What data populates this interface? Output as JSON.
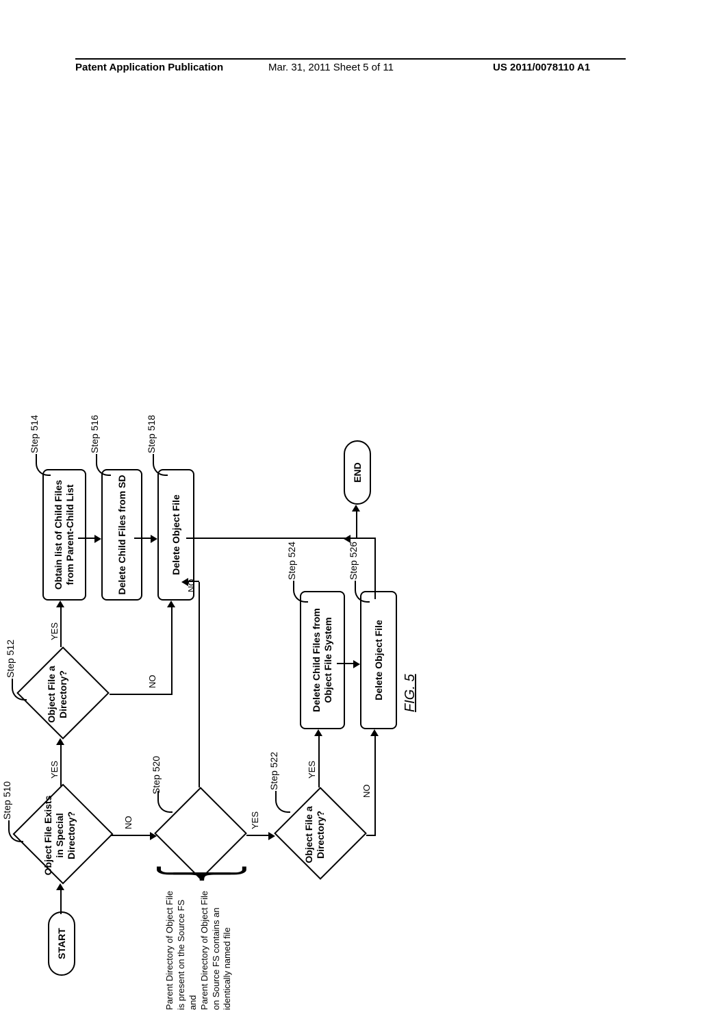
{
  "header": {
    "left": "Patent Application Publication",
    "middle": "Mar. 31, 2011  Sheet 5 of 11",
    "right": "US 2011/0078110 A1"
  },
  "figure": "FIG. 5",
  "labels": {
    "yes": "YES",
    "no": "NO"
  },
  "steps": {
    "s510": "Step 510",
    "s512": "Step 512",
    "s514": "Step 514",
    "s516": "Step 516",
    "s518": "Step 518",
    "s520": "Step 520",
    "s522": "Step 522",
    "s524": "Step 524",
    "s526": "Step 526"
  },
  "nodes": {
    "start": "START",
    "end": "END",
    "d510": "Object File Exists in Special Directory?",
    "d512": "Object File a Directory?",
    "p514": "Obtain list of Child Files from Parent-Child List",
    "p516": "Delete Child Files from SD",
    "p518": "Delete Object File",
    "d520_annot": "Parent Directory of Object File is present on the Source FS\nand\nParent Directory of Object File on Source FS contains an identically named file",
    "d522": "Object File a Directory?",
    "p524": "Delete Child Files from Object File System",
    "p526": "Delete Object File"
  },
  "chart_data": {
    "type": "flowchart",
    "nodes": [
      {
        "id": "start",
        "kind": "terminal",
        "label": "START"
      },
      {
        "id": "d510",
        "kind": "decision",
        "step": "Step 510",
        "label": "Object File Exists in Special Directory?"
      },
      {
        "id": "d512",
        "kind": "decision",
        "step": "Step 512",
        "label": "Object File a Directory?"
      },
      {
        "id": "p514",
        "kind": "process",
        "step": "Step 514",
        "label": "Obtain list of Child Files from Parent-Child List"
      },
      {
        "id": "p516",
        "kind": "process",
        "step": "Step 516",
        "label": "Delete Child Files from SD"
      },
      {
        "id": "p518",
        "kind": "process",
        "step": "Step 518",
        "label": "Delete Object File"
      },
      {
        "id": "d520",
        "kind": "decision",
        "step": "Step 520",
        "label": "Parent Directory of Object File is present on the Source FS and Parent Directory of Object File on Source FS contains an identically named file"
      },
      {
        "id": "d522",
        "kind": "decision",
        "step": "Step 522",
        "label": "Object File a Directory?"
      },
      {
        "id": "p524",
        "kind": "process",
        "step": "Step 524",
        "label": "Delete Child Files from Object File System"
      },
      {
        "id": "p526",
        "kind": "process",
        "step": "Step 526",
        "label": "Delete Object File"
      },
      {
        "id": "end",
        "kind": "terminal",
        "label": "END"
      }
    ],
    "edges": [
      {
        "from": "start",
        "to": "d510",
        "label": ""
      },
      {
        "from": "d510",
        "to": "d512",
        "label": "YES"
      },
      {
        "from": "d510",
        "to": "d520",
        "label": "NO"
      },
      {
        "from": "d512",
        "to": "p514",
        "label": "YES"
      },
      {
        "from": "d512",
        "to": "p518",
        "label": "NO"
      },
      {
        "from": "p514",
        "to": "p516",
        "label": ""
      },
      {
        "from": "p516",
        "to": "p518",
        "label": ""
      },
      {
        "from": "p518",
        "to": "end",
        "label": ""
      },
      {
        "from": "d520",
        "to": "p518",
        "label": "NO"
      },
      {
        "from": "d520",
        "to": "d522",
        "label": "YES"
      },
      {
        "from": "d522",
        "to": "p524",
        "label": "YES"
      },
      {
        "from": "d522",
        "to": "p526",
        "label": "NO"
      },
      {
        "from": "p524",
        "to": "p526",
        "label": ""
      },
      {
        "from": "p526",
        "to": "end",
        "label": ""
      }
    ]
  }
}
